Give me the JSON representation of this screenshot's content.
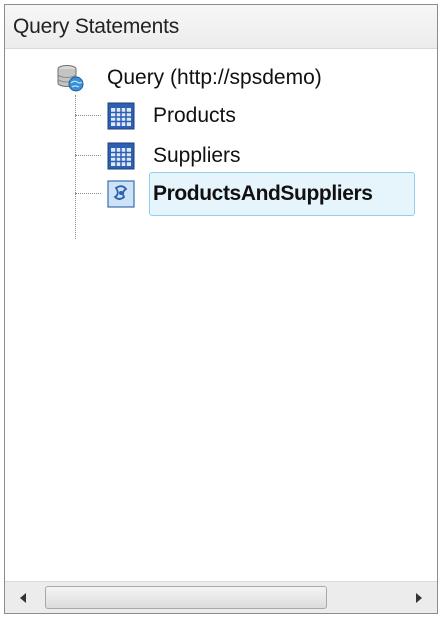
{
  "panel": {
    "title": "Query Statements"
  },
  "tree": {
    "root": {
      "label": "Query (http://spsdemo)",
      "icon": "database-globe-icon"
    },
    "children": [
      {
        "label": "Products",
        "icon": "table-icon",
        "selected": false
      },
      {
        "label": "Suppliers",
        "icon": "table-icon",
        "selected": false
      },
      {
        "label": "ProductsAndSuppliers",
        "icon": "join-query-icon",
        "selected": true
      }
    ]
  },
  "scrollbar": {
    "left_arrow": "scroll-left-icon",
    "right_arrow": "scroll-right-icon"
  },
  "colors": {
    "selection_fill": "#e6f4fc",
    "selection_border": "#8fd0ee",
    "table_icon_blue": "#2d5fb3"
  }
}
